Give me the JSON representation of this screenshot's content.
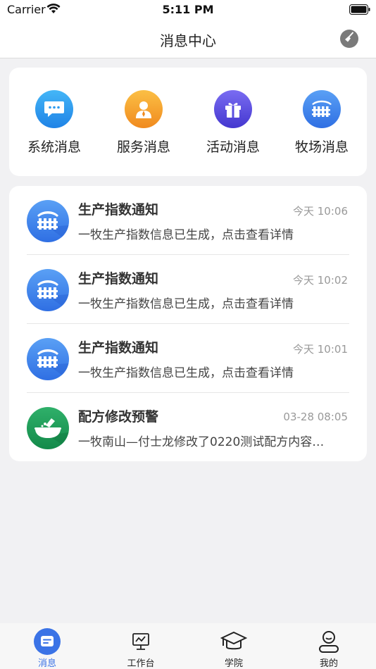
{
  "status_bar": {
    "carrier": "Carrier",
    "time": "5:11 PM"
  },
  "nav": {
    "title": "消息中心",
    "clear_icon": "broom-icon"
  },
  "categories": [
    {
      "label": "系统消息",
      "icon": "chat-bubble-icon",
      "color": "#2c9bf0"
    },
    {
      "label": "服务消息",
      "icon": "service-person-icon",
      "color": "#f7a62f"
    },
    {
      "label": "活动消息",
      "icon": "gift-icon",
      "color": "#5a4fe0"
    },
    {
      "label": "牧场消息",
      "icon": "ranch-fence-icon",
      "color": "#3f86ee"
    }
  ],
  "messages": [
    {
      "title": "生产指数通知",
      "time": "今天 10:06",
      "text": "一牧生产指数信息已生成，点击查看详情",
      "icon": "ranch-fence-icon"
    },
    {
      "title": "生产指数通知",
      "time": "今天 10:02",
      "text": "一牧生产指数信息已生成，点击查看详情",
      "icon": "ranch-fence-icon"
    },
    {
      "title": "生产指数通知",
      "time": "今天 10:01",
      "text": "一牧生产指数信息已生成，点击查看详情",
      "icon": "ranch-fence-icon"
    },
    {
      "title": "配方修改预警",
      "time": "03-28 08:05",
      "text": "一牧南山—付士龙修改了0220测试配方内容…",
      "icon": "feed-bowl-icon"
    }
  ],
  "tabs": [
    {
      "label": "消息",
      "icon": "message-icon",
      "active": true
    },
    {
      "label": "工作台",
      "icon": "monitor-chart-icon",
      "active": false
    },
    {
      "label": "学院",
      "icon": "graduation-cap-icon",
      "active": false
    },
    {
      "label": "我的",
      "icon": "user-icon",
      "active": false
    }
  ],
  "colors": {
    "accent": "#3b73e6",
    "background": "#f1f1f3",
    "card": "#ffffff"
  }
}
